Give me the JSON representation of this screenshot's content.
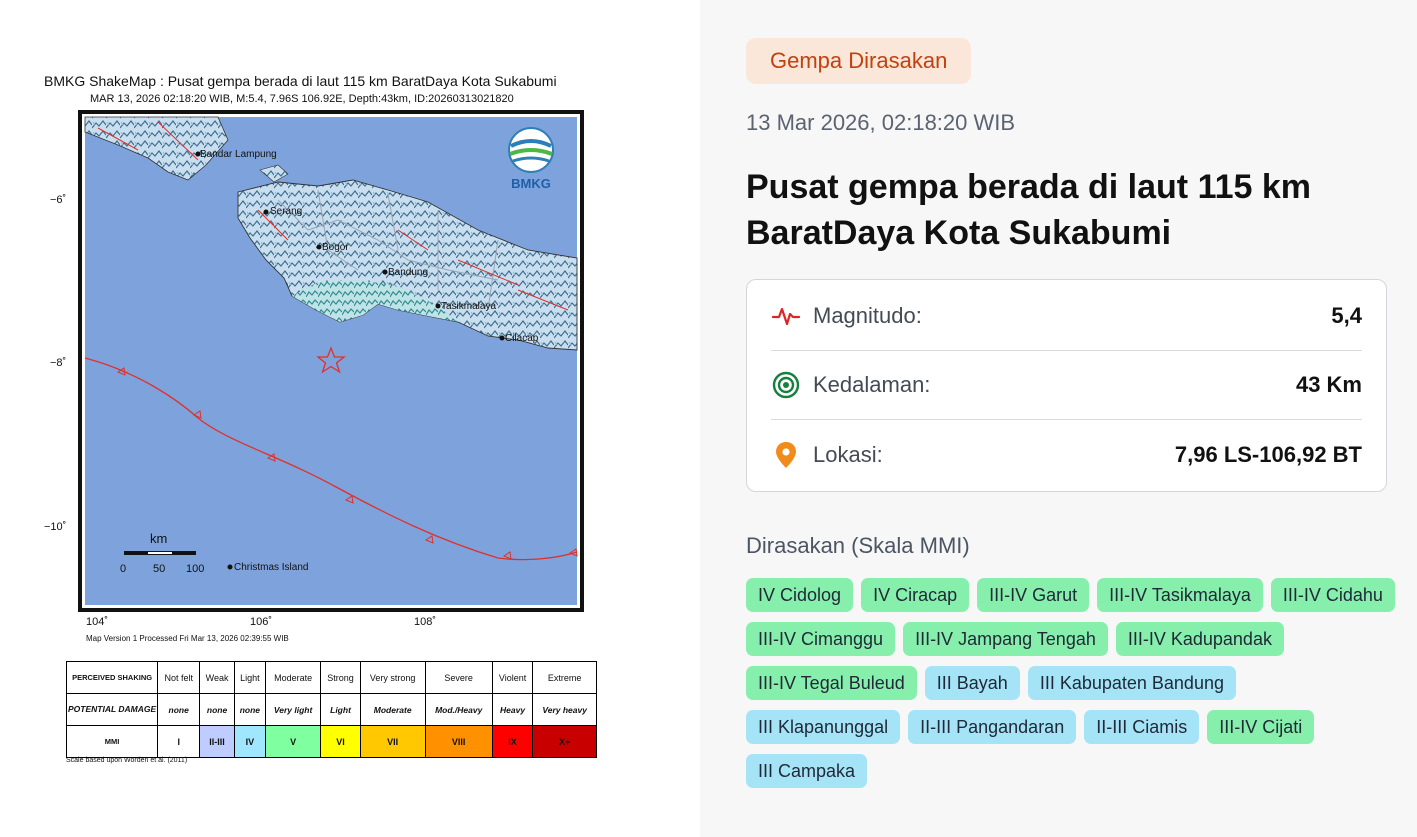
{
  "map": {
    "title": "BMKG ShakeMap : Pusat gempa berada di laut 115 km BaratDaya Kota Sukabumi",
    "subtitle": "MAR 13, 2026 02:18:20 WIB, M:5.4, 7.96S 106.92E, Depth:43km, ID:20260313021820",
    "logo_text": "BMKG",
    "lat_ticks": [
      "−6˚",
      "−8˚",
      "−10˚"
    ],
    "lon_ticks": [
      "104˚",
      "106˚",
      "108˚"
    ],
    "places": [
      "Bandar Lampung",
      "Serang",
      "Bogor",
      "Bandung",
      "Tasikmalaya",
      "Cilacap",
      "Christmas Island"
    ],
    "scale_unit": "km",
    "scale_ticks": [
      "0",
      "50",
      "100"
    ],
    "version_text": "Map Version 1 Processed Fri Mar 13, 2026 02:39:55 WIB",
    "colors": {
      "sea": "#7ea3dc",
      "trench": "#e0302a",
      "epicenter": "#e0302a"
    }
  },
  "legend": {
    "shaking_header": "PERCEIVED SHAKING",
    "damage_header": "POTENTIAL DAMAGE",
    "mmi_header": "MMI",
    "shaking": [
      "Not felt",
      "Weak",
      "Light",
      "Moderate",
      "Strong",
      "Very strong",
      "Severe",
      "Violent",
      "Extreme"
    ],
    "damage": [
      "none",
      "none",
      "none",
      "Very light",
      "Light",
      "Moderate",
      "Mod./Heavy",
      "Heavy",
      "Very heavy"
    ],
    "mmi": [
      "I",
      "II-III",
      "IV",
      "V",
      "VI",
      "VII",
      "VIII",
      "IX",
      "X+"
    ],
    "mmi_colors": [
      "#ffffff",
      "#bfccff",
      "#a0e6ff",
      "#80ffa0",
      "#ffff00",
      "#ffc800",
      "#ff9100",
      "#ff0000",
      "#c80000"
    ],
    "note": "Scale based upon Worden et al. (2011)"
  },
  "panel": {
    "badge": "Gempa Dirasakan",
    "timestamp": "13 Mar 2026, 02:18:20 WIB",
    "headline": "Pusat gempa berada di laut 115 km BaratDaya Kota Sukabumi",
    "details": [
      {
        "icon": "activity-pulse-icon",
        "label": "Magnitudo:",
        "value": "5,4"
      },
      {
        "icon": "target-rings-icon",
        "label": "Kedalaman:",
        "value": "43 Km"
      },
      {
        "icon": "location-pin-icon",
        "label": "Lokasi:",
        "value": "7,96 LS-106,92 BT"
      }
    ],
    "felt_title": "Dirasakan (Skala MMI)",
    "felt": [
      {
        "text": "IV Cidolog",
        "level": "iv"
      },
      {
        "text": "IV Ciracap",
        "level": "iv"
      },
      {
        "text": "III-IV Garut",
        "level": "iii-iv"
      },
      {
        "text": "III-IV Tasikmalaya",
        "level": "iii-iv"
      },
      {
        "text": "III-IV Cidahu",
        "level": "iii-iv"
      },
      {
        "text": "III-IV Cimanggu",
        "level": "iii-iv"
      },
      {
        "text": "III-IV Jampang Tengah",
        "level": "iii-iv"
      },
      {
        "text": "III-IV Kadupandak",
        "level": "iii-iv"
      },
      {
        "text": "III-IV Tegal Buleud",
        "level": "iii-iv"
      },
      {
        "text": "III Bayah",
        "level": "iii"
      },
      {
        "text": "III Kabupaten Bandung",
        "level": "iii"
      },
      {
        "text": "III Klapanunggal",
        "level": "iii"
      },
      {
        "text": "II-III Pangandaran",
        "level": "ii-iii"
      },
      {
        "text": "II-III Ciamis",
        "level": "ii-iii"
      },
      {
        "text": "III-IV Cijati",
        "level": "iii-iv"
      },
      {
        "text": "III Campaka",
        "level": "iii"
      }
    ],
    "colors": {
      "badge_bg": "#fbe6da",
      "badge_text": "#c2410c",
      "tag_green": "#86efac",
      "tag_blue": "#a5e3f7",
      "icon_red": "#dc2626",
      "icon_green": "#15803d",
      "icon_orange": "#f08c1c"
    }
  }
}
